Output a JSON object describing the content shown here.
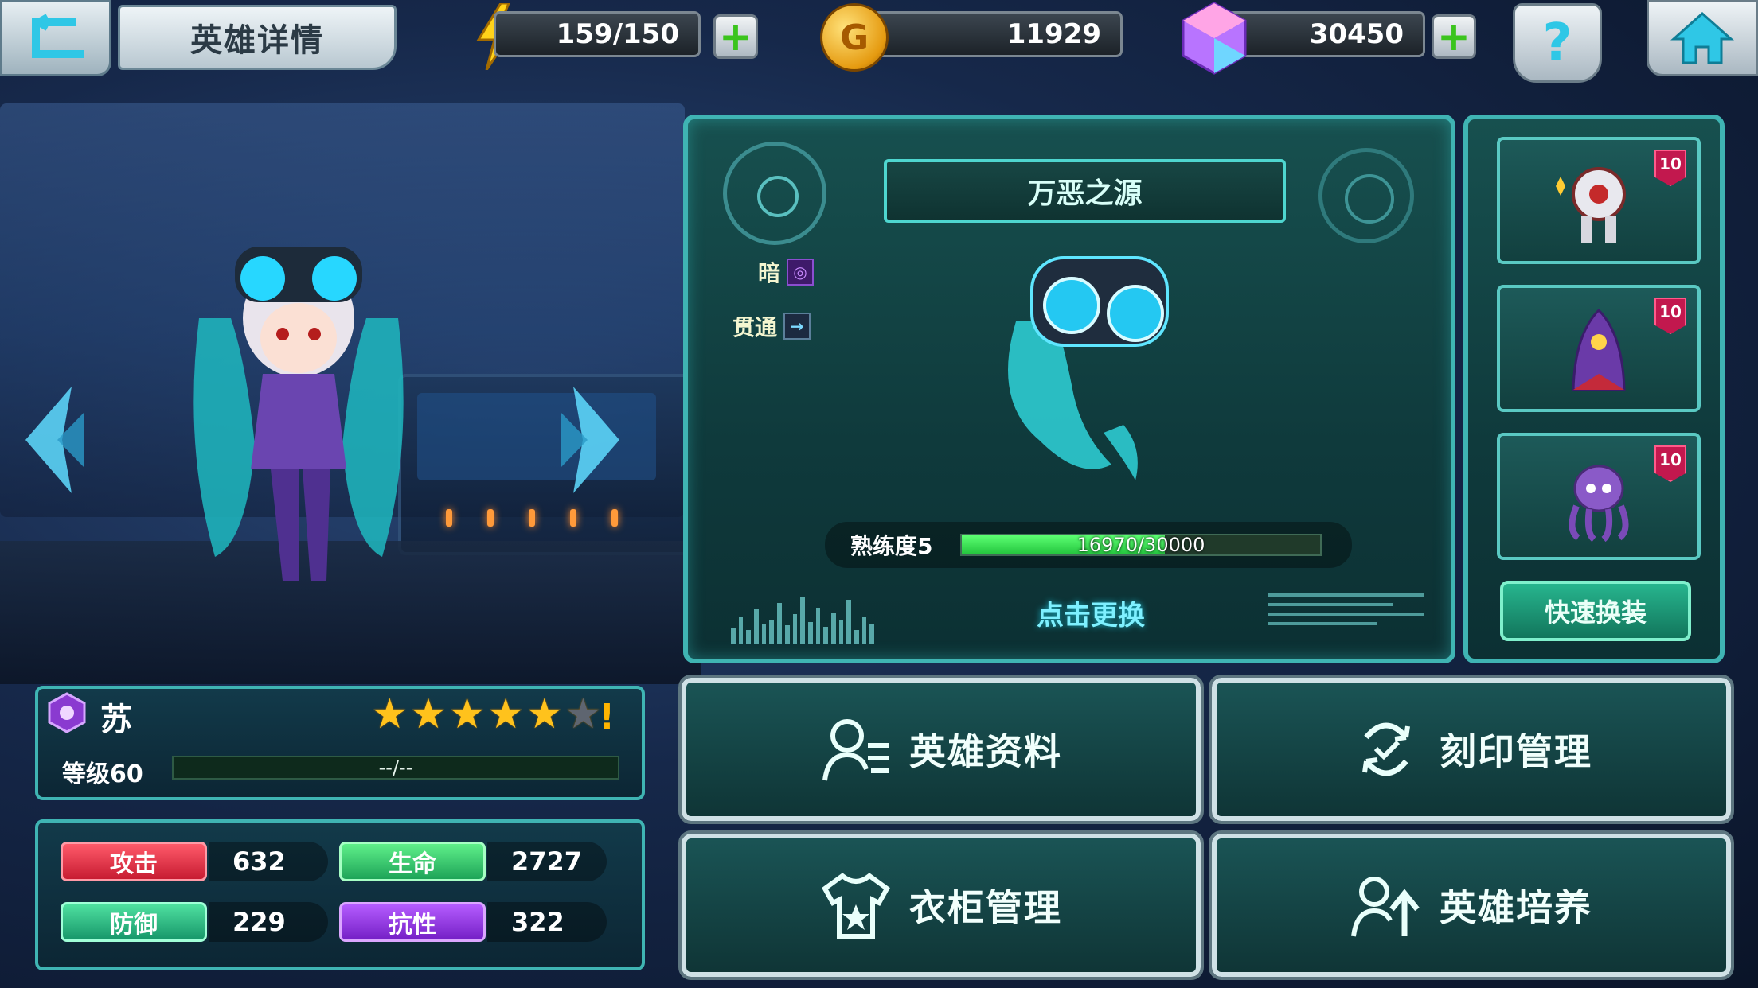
{
  "header": {
    "title": "英雄详情"
  },
  "resources": {
    "energy": "159/150",
    "gold": "11929",
    "gold_symbol": "G",
    "gems": "30450",
    "plus": "+"
  },
  "help": {
    "label": "?"
  },
  "weapon": {
    "name": "万恶之源",
    "attributes": [
      {
        "label": "暗",
        "icon": "dark-element-icon"
      },
      {
        "label": "贯通",
        "icon": "pierce-arrow-icon"
      }
    ],
    "mastery_label": "熟练度5",
    "mastery_value": "16970/30000",
    "mastery_fraction": 0.5657,
    "change_label": "点击更换"
  },
  "equipment": {
    "slots": [
      {
        "level": "10",
        "icon": "armor-robot-icon"
      },
      {
        "level": "10",
        "icon": "purple-cloak-icon"
      },
      {
        "level": "10",
        "icon": "octopus-accessory-icon"
      }
    ],
    "quick_change_label": "快速换装"
  },
  "hero": {
    "name": "苏",
    "stars_filled": 5,
    "stars_total": 6,
    "alert": "!",
    "level_label": "等级60",
    "exp_text": "--/--"
  },
  "stats": {
    "attack_label": "攻击",
    "attack": "632",
    "hp_label": "生命",
    "hp": "2727",
    "defense_label": "防御",
    "defense": "229",
    "resist_label": "抗性",
    "resist": "322"
  },
  "menu": {
    "hero_info": "英雄资料",
    "imprint": "刻印管理",
    "wardrobe": "衣柜管理",
    "training": "英雄培养"
  },
  "colors": {
    "accent": "#3fb4b3",
    "gold": "#ffc21c",
    "mastery": "#3ee05a"
  }
}
